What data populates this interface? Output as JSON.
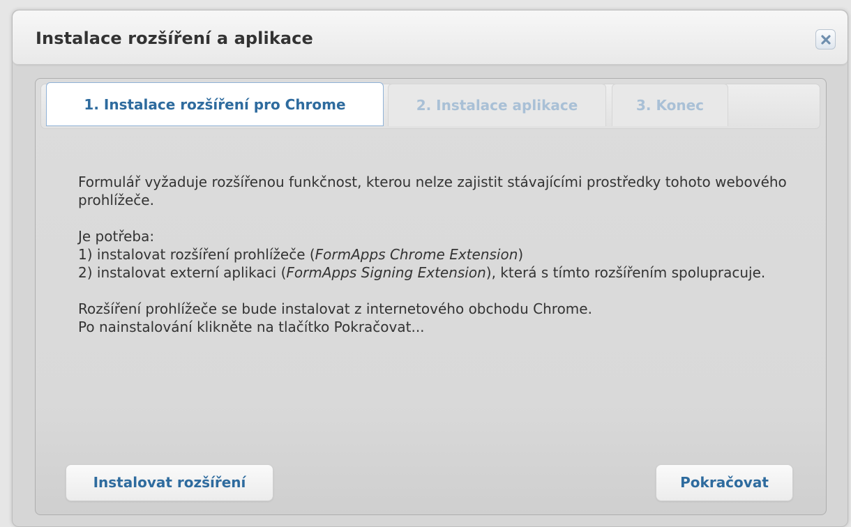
{
  "dialog": {
    "title": "Instalace rozšíření a aplikace",
    "close_icon": "close-x-icon"
  },
  "tabs": [
    {
      "label": "1. Instalace rozšíření pro Chrome",
      "active": true
    },
    {
      "label": "2. Instalace aplikace",
      "active": false
    },
    {
      "label": "3. Konec",
      "active": false
    }
  ],
  "content": {
    "para1": "Formulář vyžaduje rozšířenou funkčnost, kterou nelze zajistit stávajícími prostředky tohoto webového prohlížeče.",
    "need_heading": "Je potřeba:",
    "item1_prefix": "1) instalovat rozšíření prohlížeče (",
    "item1_name": "FormApps Chrome Extension",
    "item1_suffix": ")",
    "item2_prefix": "2) instalovat externí aplikaci (",
    "item2_name": "FormApps Signing Extension",
    "item2_suffix": "), která s tímto rozšířením spolupracuje.",
    "para3_line1": "Rozšíření prohlížeče se bude instalovat z internetového obchodu Chrome.",
    "para3_line2": "Po nainstalování klikněte na tlačítko Pokračovat..."
  },
  "buttons": {
    "install_label": "Instalovat rozšíření",
    "continue_label": "Pokračovat"
  },
  "colors": {
    "accent": "#2e6b9e",
    "inactive_tab_text": "#a9c0d6"
  }
}
